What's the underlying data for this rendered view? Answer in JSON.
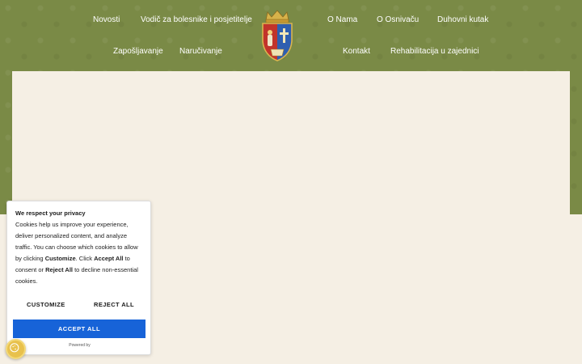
{
  "nav": {
    "left_row1": [
      "Novosti",
      "Vodič za bolesnike i posjetitelje"
    ],
    "left_row2": [
      "Zapošljavanje",
      "Naručivanje"
    ],
    "right_row1": [
      "O Nama",
      "O Osnivaču",
      "Duhovni kutak"
    ],
    "right_row2": [
      "Kontakt",
      "Rehabilitacija u zajednici"
    ]
  },
  "logo": {
    "icon": "coat-of-arms-icon"
  },
  "cookie_banner": {
    "title": "We respect your privacy",
    "text_1": "Cookies help us improve your experience, deliver personalized content, and analyze traffic. You can choose which cookies to allow by clicking ",
    "text_customize": "Customize",
    "text_2": ". Click ",
    "text_accept": "Accept All",
    "text_3": " to consent or ",
    "text_reject": "Reject All",
    "text_4": " to decline non-essential cookies.",
    "customize_label": "CUSTOMIZE",
    "reject_label": "REJECT ALL",
    "accept_label": "ACCEPT ALL",
    "powered_by": "Powered by"
  },
  "colors": {
    "header_green": "#7a8a46",
    "page_bg": "#f5efe4",
    "accept_blue": "#1763d8",
    "badge_gold": "#e8c14d"
  }
}
